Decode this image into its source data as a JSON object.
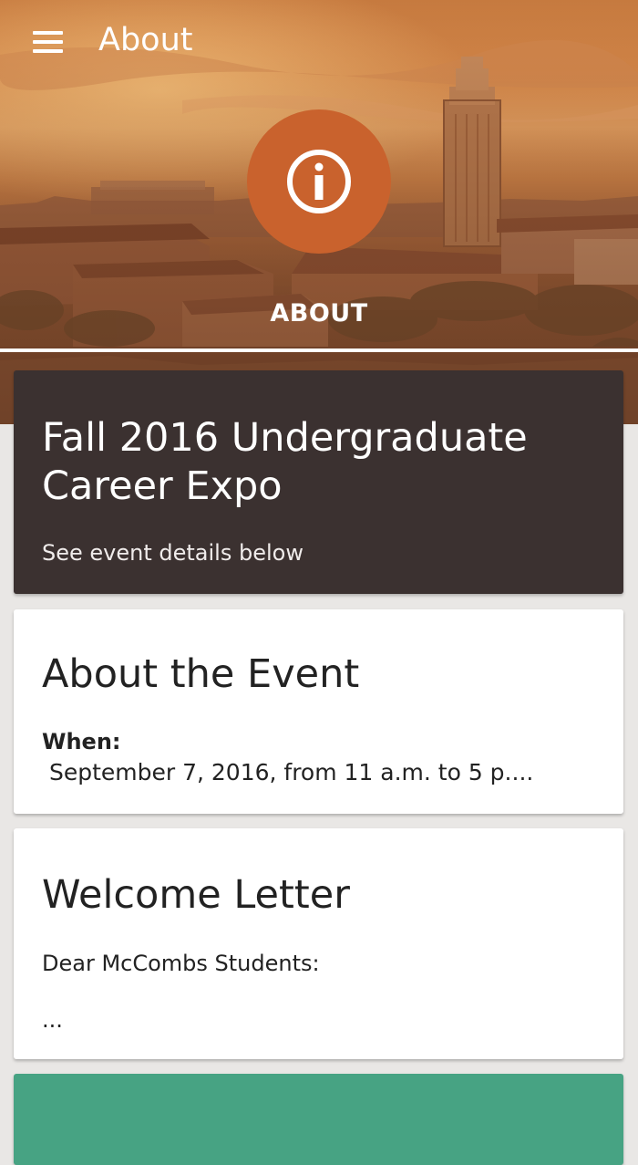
{
  "app_bar": {
    "title": "About",
    "menu_icon": "hamburger-menu-icon"
  },
  "hero": {
    "icon": "info-icon",
    "label": "ABOUT",
    "accent": "#c9622d"
  },
  "event_card": {
    "title": "Fall 2016 Undergraduate Career Expo",
    "subtitle": "See event details below",
    "background": "#3b3130"
  },
  "about_card": {
    "heading": "About the Event",
    "when_label": "When:",
    "when_value": " September 7, 2016, from 11 a.m. to 5 p...."
  },
  "letter_card": {
    "heading": "Welcome Letter",
    "greeting": "Dear McCombs Students:",
    "ellipsis": "..."
  },
  "next_card": {
    "background": "#47a383"
  }
}
